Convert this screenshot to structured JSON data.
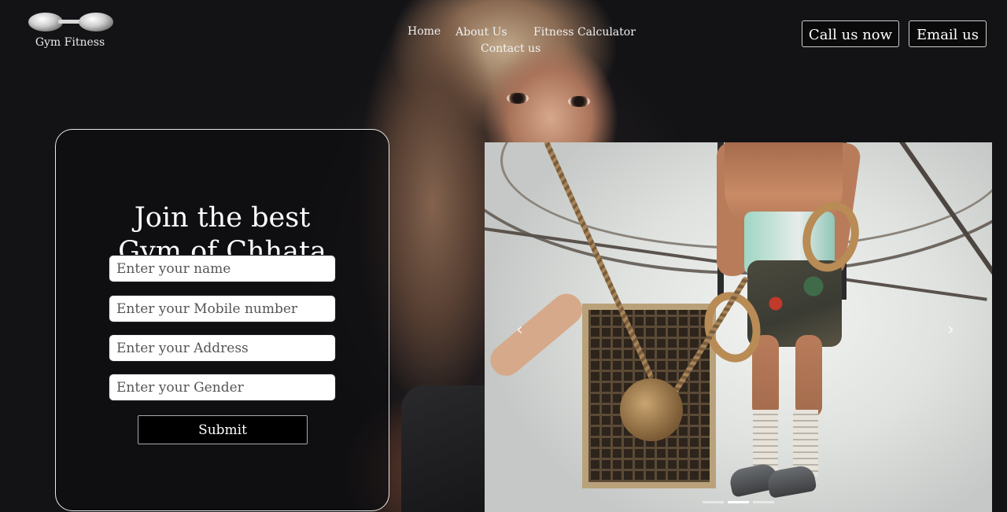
{
  "brand": {
    "name": "Gym Fitness",
    "logo_icon": "dumbbell-logo"
  },
  "nav": {
    "home": "Home",
    "about": "About Us",
    "fitness_calculator": "Fitness Calculator",
    "contact": "Contact us"
  },
  "header_buttons": {
    "call": "Call us now",
    "email": "Email us"
  },
  "form": {
    "title_line1": "Join the best",
    "title_line2": "Gym of Chhata",
    "name_placeholder": "Enter your name",
    "mobile_placeholder": "Enter your Mobile number",
    "address_placeholder": "Enter your Address",
    "gender_placeholder": "Enter your Gender",
    "submit_label": "Submit"
  },
  "carousel": {
    "prev_icon": "chevron-left-icon",
    "next_icon": "chevron-right-icon",
    "prev_glyph": "‹",
    "next_glyph": "›",
    "slide_count": 3,
    "active_index": 1
  },
  "colors": {
    "background": "#131316",
    "button_bg": "#000000",
    "text": "#ffffff"
  }
}
